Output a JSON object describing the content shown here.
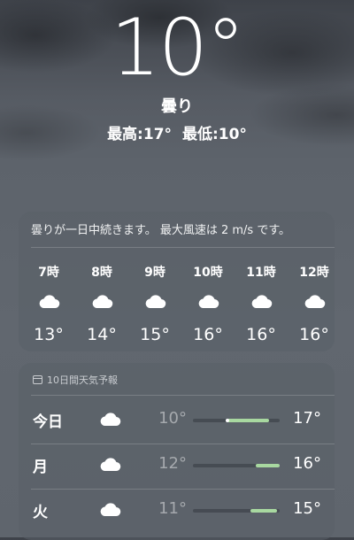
{
  "current": {
    "temperature": "10°",
    "condition": "曇り",
    "high": "最高:17°",
    "low": "最低:10°"
  },
  "hourly": {
    "summary": "曇りが一日中続きます。 最大風速は 2 m/s です。",
    "hours": [
      {
        "time": "7時",
        "icon": "cloud-icon",
        "temp": "13°"
      },
      {
        "time": "8時",
        "icon": "cloud-icon",
        "temp": "14°"
      },
      {
        "time": "9時",
        "icon": "cloud-icon",
        "temp": "15°"
      },
      {
        "time": "10時",
        "icon": "cloud-icon",
        "temp": "16°"
      },
      {
        "time": "11時",
        "icon": "cloud-icon",
        "temp": "16°"
      },
      {
        "time": "12時",
        "icon": "cloud-icon",
        "temp": "16°"
      }
    ]
  },
  "daily": {
    "header": "10日間天気予報",
    "header_icon": "calendar-icon",
    "rows": [
      {
        "day": "今日",
        "icon": "cloud-icon",
        "low": "10°",
        "high": "17°",
        "range_start": 0.4,
        "range_end": 0.88,
        "current_marker": 0.4
      },
      {
        "day": "月",
        "icon": "cloud-icon",
        "low": "12°",
        "high": "16°",
        "range_start": 0.72,
        "range_end": 1.0
      },
      {
        "day": "火",
        "icon": "cloud-icon",
        "low": "11°",
        "high": "15°",
        "range_start": 0.66,
        "range_end": 0.97
      }
    ]
  },
  "colors": {
    "range_fill": "#a8d8a0",
    "background": "#5f656d"
  }
}
